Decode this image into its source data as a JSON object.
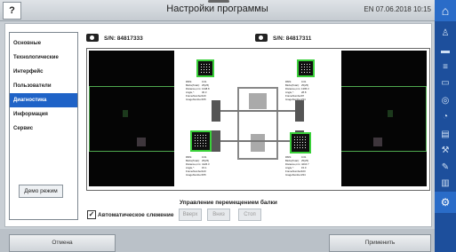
{
  "window": {
    "title": "Настройки программы",
    "help": "?",
    "status": "EN 07.06.2018 10:15"
  },
  "sidebar": {
    "items": [
      "Основные",
      "Технологические",
      "Интерфейс",
      "Пользователи",
      "Диагностика",
      "Информация",
      "Сервис"
    ],
    "active": "Диагностика"
  },
  "demo_button": "Демо режим",
  "cameras": [
    {
      "serial": "S/N: 84817333"
    },
    {
      "serial": "S/N: 84817311"
    }
  ],
  "stats": [
    {
      "rows": [
        [
          "RMS:",
          "0.01"
        ],
        [
          "Blobs(Total):",
          "25(25)"
        ],
        [
          "Distance,mm:",
          "1348.8"
        ],
        [
          "Angle,°:",
          "30.3"
        ],
        [
          "FrameNumber:",
          "120"
        ],
        [
          "ImageNumber:",
          "155"
        ]
      ]
    },
    {
      "rows": [
        [
          "RMS:",
          "0.01"
        ],
        [
          "Blobs(Total):",
          "25(25)"
        ],
        [
          "Distance,mm:",
          "1395.3"
        ],
        [
          "Angle,°:",
          "28.8"
        ],
        [
          "FrameNumber:",
          "97"
        ],
        [
          "ImageNumber:",
          "234"
        ]
      ]
    },
    {
      "rows": [
        [
          "RMS:",
          "0.01"
        ],
        [
          "Blobs(Total):",
          "25(25)"
        ],
        [
          "Distance,mm:",
          "4126.3"
        ],
        [
          "Angle,°:",
          "15.1"
        ],
        [
          "FrameNumber:",
          "120"
        ],
        [
          "ImageNumber:",
          "155"
        ]
      ]
    },
    {
      "rows": [
        [
          "RMS:",
          "0.01"
        ],
        [
          "Blobs(Total):",
          "25(25)"
        ],
        [
          "Distance,mm:",
          "4216.7"
        ],
        [
          "Angle,°:",
          "15.0"
        ],
        [
          "FrameNumber:",
          "100"
        ],
        [
          "ImageNumber:",
          "234"
        ]
      ]
    }
  ],
  "controls": {
    "auto_tracking": "Автоматическое слежение",
    "auto_tracking_checked": true,
    "beam_label": "Управление перемещением балки",
    "up": "Вверх",
    "down": "Вниз",
    "stop": "Стоп"
  },
  "footer": {
    "cancel": "Отмена",
    "apply": "Применить"
  },
  "rail": {
    "icons": [
      "home-icon",
      "person-icon",
      "car-icon",
      "list-icon",
      "card-icon",
      "disc-icon",
      "gauge-icon",
      "document-icon",
      "wrench-icon",
      "tools-icon",
      "database-icon",
      "settings-icon"
    ]
  }
}
